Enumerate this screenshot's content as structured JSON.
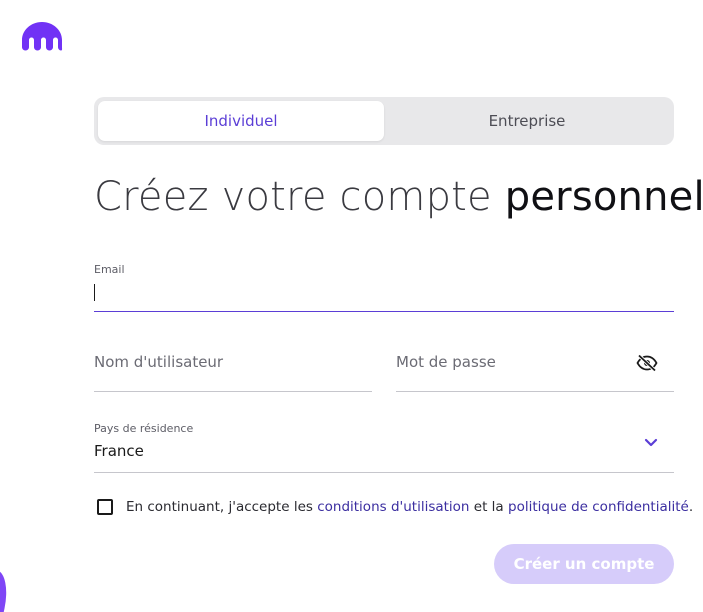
{
  "brand": {
    "logo_icon": "kraken-logo-icon",
    "accent_color": "#7132f5"
  },
  "tabs": [
    {
      "label": "Individuel",
      "active": true
    },
    {
      "label": "Entreprise",
      "active": false
    }
  ],
  "headline": {
    "light": "Créez votre compte ",
    "bold": "personnel"
  },
  "email": {
    "label": "Email",
    "value": ""
  },
  "username": {
    "placeholder": "Nom d'utilisateur"
  },
  "password": {
    "placeholder": "Mot de passe",
    "toggle_icon": "eye-slash-icon"
  },
  "country": {
    "label": "Pays de résidence",
    "value": "France",
    "dropdown_icon": "chevron-down-icon"
  },
  "consent": {
    "checked": false,
    "text_before": "En continuant, j'accepte les ",
    "terms_link": "conditions d'utilisation",
    "text_middle": " et la ",
    "privacy_link": "politique de confidentialité",
    "text_after": "."
  },
  "submit": {
    "label": "Créer un compte",
    "disabled_color": "#d6ccfa"
  }
}
